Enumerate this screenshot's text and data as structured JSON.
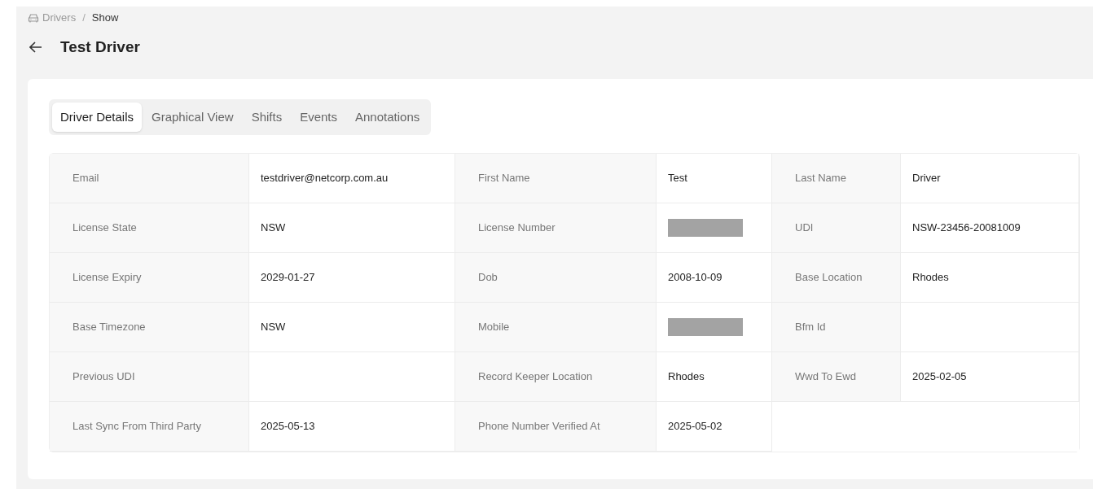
{
  "breadcrumb": [
    {
      "label": "Drivers"
    },
    {
      "label": "Show"
    }
  ],
  "breadcrumb_separator": "/",
  "title": "Test Driver",
  "tabs": [
    {
      "label": "Driver Details",
      "selected": true
    },
    {
      "label": "Graphical View",
      "selected": false
    },
    {
      "label": "Shifts",
      "selected": false
    },
    {
      "label": "Events",
      "selected": false
    },
    {
      "label": "Annotations",
      "selected": false
    }
  ],
  "fields": [
    {
      "label": "Email",
      "value": "testdriver@netcorp.com.au"
    },
    {
      "label": "First Name",
      "value": "Test"
    },
    {
      "label": "Last Name",
      "value": "Driver"
    },
    {
      "label": "License State",
      "value": "NSW"
    },
    {
      "label": "License Number",
      "kind": "redacted"
    },
    {
      "label": "UDI",
      "value": "NSW-23456-20081009"
    },
    {
      "label": "License Expiry",
      "value": "2029-01-27"
    },
    {
      "label": "Dob",
      "value": "2008-10-09"
    },
    {
      "label": "Base Location",
      "value": "Rhodes"
    },
    {
      "label": "Base Timezone",
      "value": "NSW"
    },
    {
      "label": "Mobile",
      "kind": "redacted"
    },
    {
      "label": "Bfm Id"
    },
    {
      "label": "Previous UDI"
    },
    {
      "label": "Record Keeper Location",
      "value": "Rhodes"
    },
    {
      "label": "Wwd To Ewd",
      "value": "2025-02-05"
    },
    {
      "label": "Last Sync From Third Party",
      "value": "2025-05-13"
    },
    {
      "label": "Phone Number Verified At",
      "value": "2025-05-02"
    }
  ]
}
